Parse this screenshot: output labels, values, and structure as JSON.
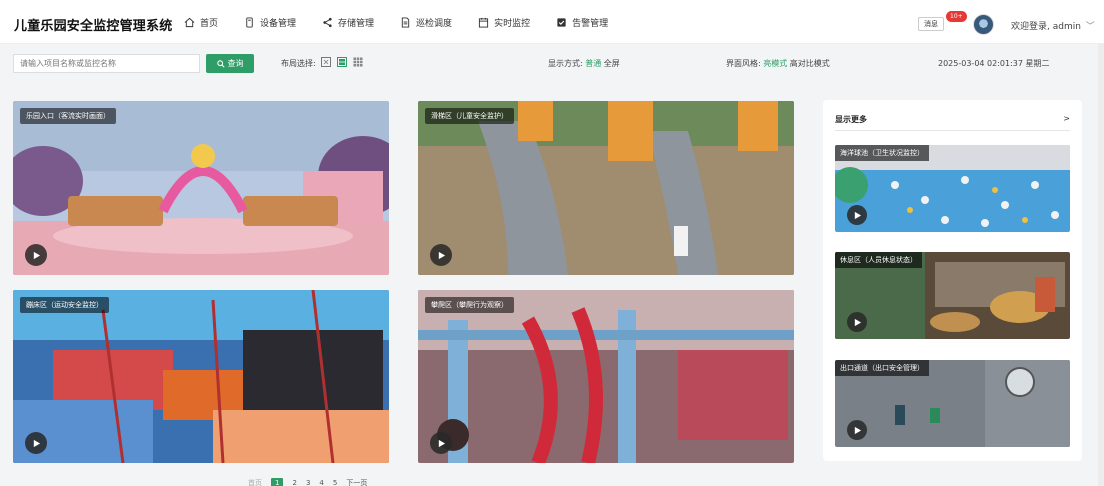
{
  "app": {
    "title": "儿童乐园安全监控管理系统"
  },
  "nav": [
    {
      "label": "首页",
      "icon": "home-icon"
    },
    {
      "label": "设备管理",
      "icon": "device-icon"
    },
    {
      "label": "存储管理",
      "icon": "share-icon"
    },
    {
      "label": "巡检调度",
      "icon": "document-icon"
    },
    {
      "label": "实时监控",
      "icon": "calendar-icon"
    },
    {
      "label": "告警管理",
      "icon": "checkbox-icon"
    }
  ],
  "header": {
    "message_label": "消息",
    "badge": "10+",
    "welcome": "欢迎登录, admin"
  },
  "toolbar": {
    "search_placeholder": "请输入项目名称或监控名称",
    "search_button": "查询",
    "layout_label": "布局选择:",
    "display_label": "显示方式:",
    "display_normal": "普通",
    "display_full": "全屏",
    "theme_label": "界面风格:",
    "theme_light": "亮模式",
    "theme_contrast": "高对比模式",
    "datetime": "2025-03-04 02:01:37 星期二"
  },
  "cameras": [
    {
      "label": "乐园入口（客流实时画面）"
    },
    {
      "label": "滑梯区（儿童安全监护）"
    },
    {
      "label": "蹦床区（运动安全监控）"
    },
    {
      "label": "攀爬区（攀爬行为观察）"
    }
  ],
  "side": {
    "title": "显示更多",
    "more": ">",
    "cameras": [
      {
        "label": "海洋球池（卫生状况监控）"
      },
      {
        "label": "休息区（人员休息状态）"
      },
      {
        "label": "出口通道（出口安全管理）"
      }
    ]
  },
  "pagination": {
    "first": "首页",
    "pages": [
      "1",
      "2",
      "3",
      "4",
      "5"
    ],
    "next": "下一页",
    "current": "1"
  },
  "colors": {
    "accent": "#2e9d67",
    "badge": "#e53935"
  }
}
